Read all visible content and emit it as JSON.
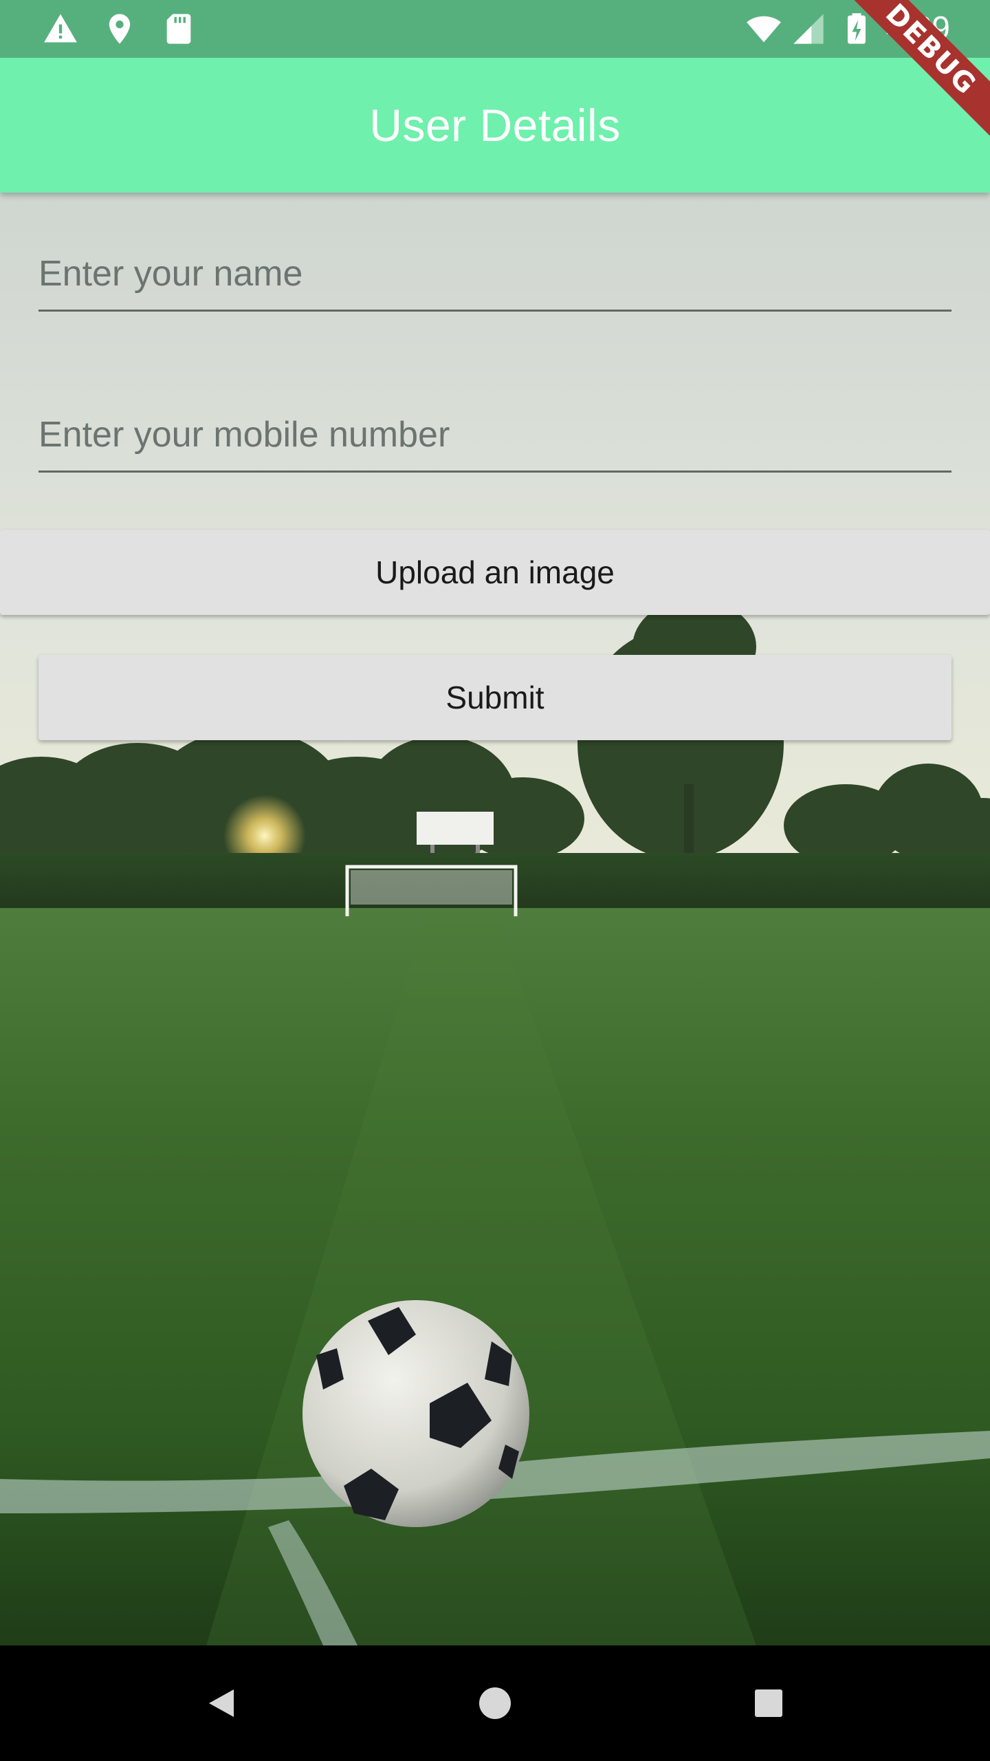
{
  "status_bar": {
    "time": "4:39",
    "left_icons": [
      "warning-icon",
      "location-pin-icon",
      "sd-card-icon"
    ],
    "right_icons": [
      "wifi-icon",
      "cellular-signal-icon",
      "battery-charging-icon"
    ]
  },
  "debug_banner": {
    "label": "DEBUG",
    "color": "#a8322e"
  },
  "app_bar": {
    "title": "User Details",
    "color": "#6ff0ad"
  },
  "form": {
    "name_field": {
      "placeholder": "Enter your name",
      "value": ""
    },
    "mobile_field": {
      "placeholder": "Enter your mobile number",
      "value": ""
    },
    "upload_button_label": "Upload an image",
    "submit_button_label": "Submit"
  },
  "background": {
    "description_icon": "soccer-field-background-image"
  },
  "nav_bar": {
    "buttons": [
      "back-icon",
      "home-icon",
      "recents-icon"
    ]
  }
}
